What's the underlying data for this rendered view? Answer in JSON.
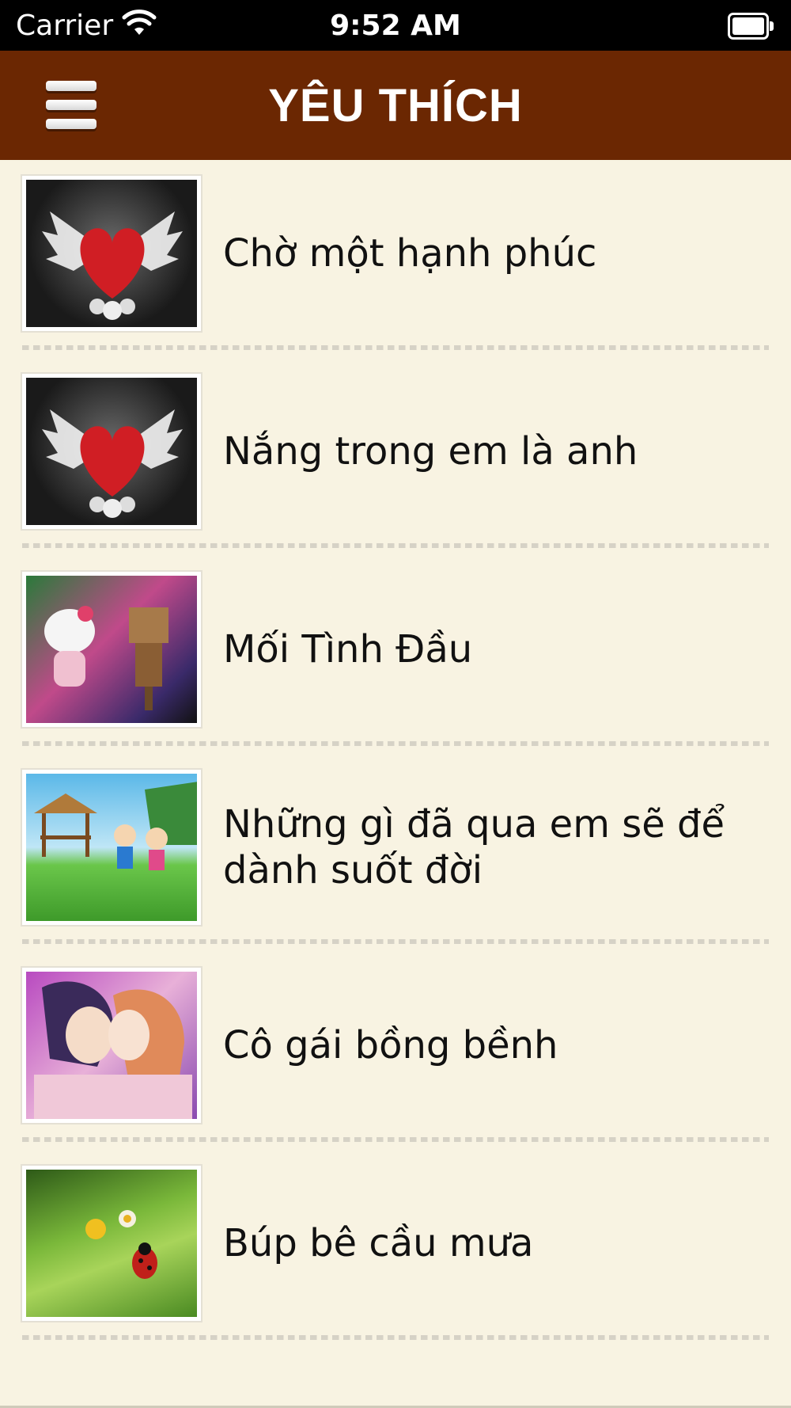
{
  "status": {
    "carrier": "Carrier",
    "time": "9:52 AM"
  },
  "header": {
    "title": "YÊU THÍCH",
    "menu_icon": "hamburger-menu-icon"
  },
  "items": [
    {
      "title": "Chờ một hạnh phúc",
      "thumb": "winged-heart"
    },
    {
      "title": "Nắng trong em là anh",
      "thumb": "winged-heart"
    },
    {
      "title": "Mối Tình Đầu",
      "thumb": "toy-couple"
    },
    {
      "title": "Những gì đã qua em sẽ để dành suốt đời",
      "thumb": "cartoon-kids"
    },
    {
      "title": "Cô gái bồng bềnh",
      "thumb": "anime-couple"
    },
    {
      "title": "Búp bê cầu mưa",
      "thumb": "leaf-ladybug"
    }
  ],
  "colors": {
    "nav_bg": "#6b2702",
    "page_bg": "#f8f3e2",
    "text": "#111111"
  }
}
